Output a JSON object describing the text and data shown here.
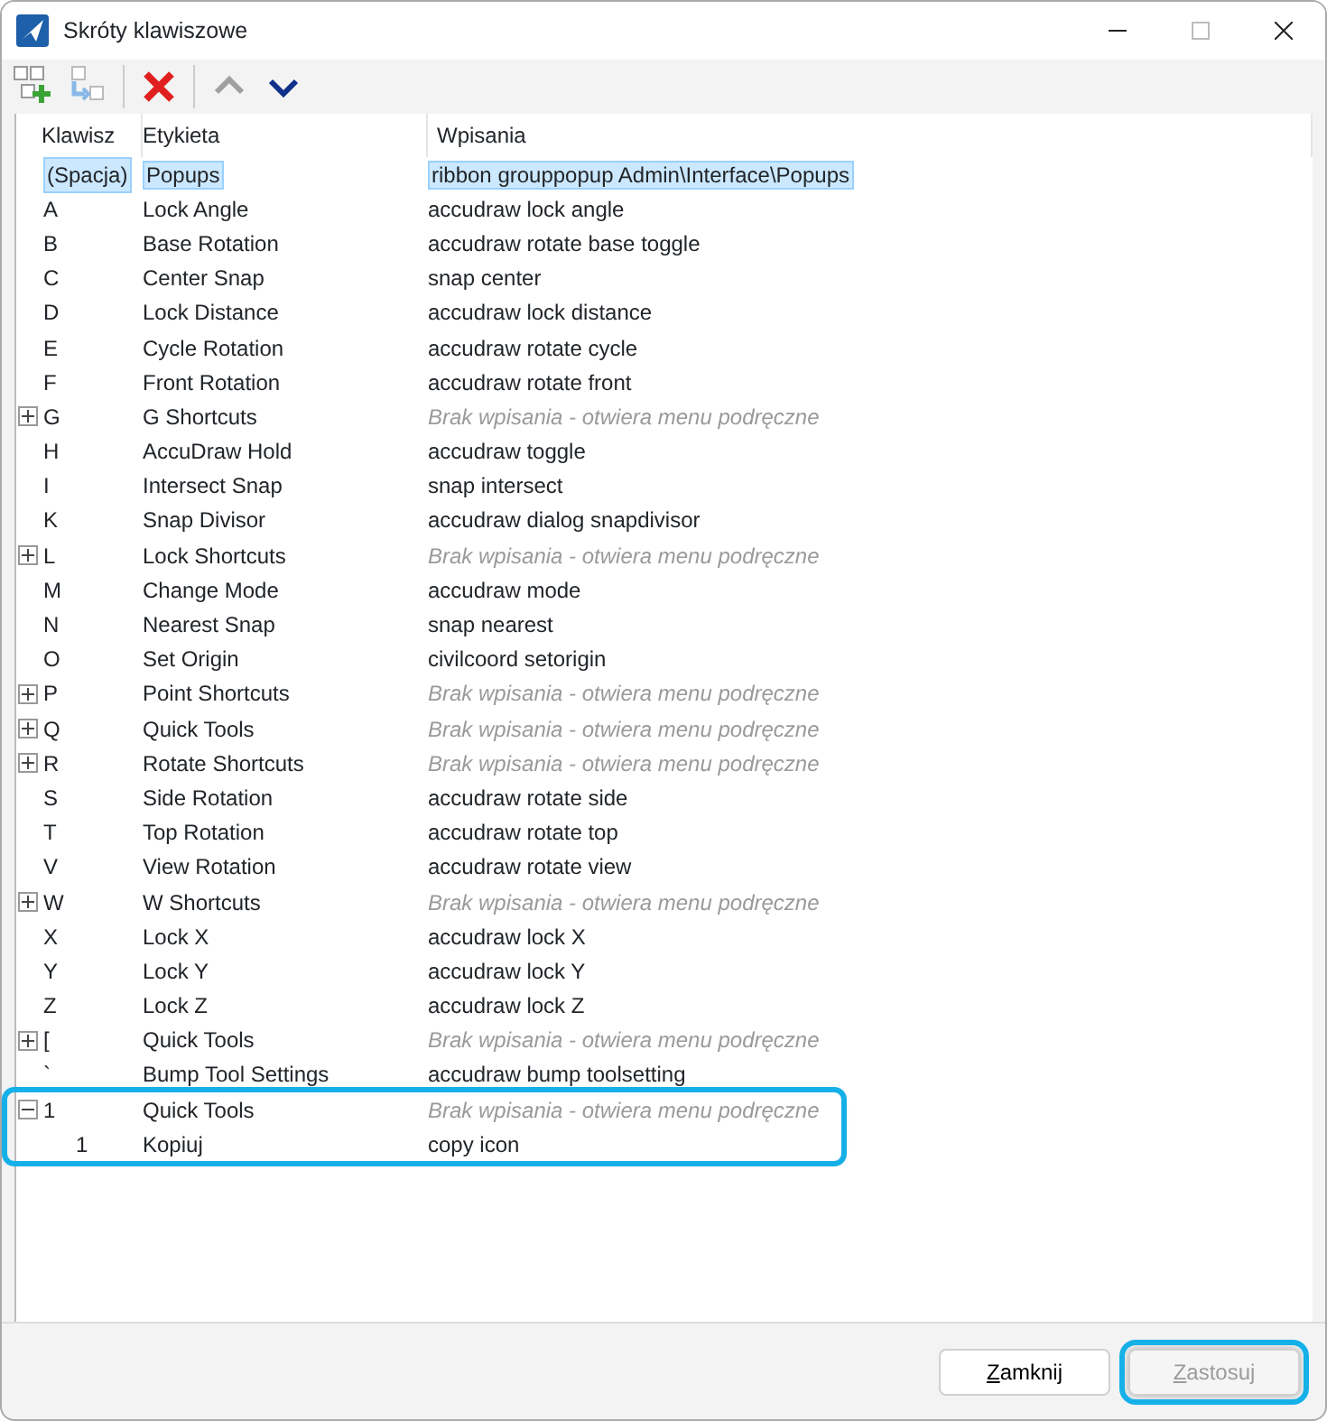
{
  "window": {
    "title": "Skróty klawiszowe"
  },
  "toolbar": [
    {
      "kind": "add",
      "disabled": false
    },
    {
      "kind": "add-child",
      "disabled": true
    },
    {
      "kind": "delete",
      "disabled": false
    },
    {
      "kind": "up",
      "disabled": true
    },
    {
      "kind": "down",
      "disabled": false
    }
  ],
  "table": {
    "columns": [
      "Klawisz",
      "Etykieta",
      "Wpisania"
    ],
    "rows": [
      {
        "key": "(Spacja)",
        "label": "Popups",
        "command": "ribbon grouppopup Admin\\Interface\\Popups",
        "kind": "command",
        "selected": true
      },
      {
        "key": "A",
        "label": "Lock Angle",
        "command": "accudraw lock angle",
        "kind": "command",
        "selected": false
      },
      {
        "key": "B",
        "label": "Base Rotation",
        "command": "accudraw rotate base toggle",
        "kind": "command",
        "selected": false
      },
      {
        "key": "C",
        "label": "Center Snap",
        "command": "snap center",
        "kind": "command",
        "selected": false
      },
      {
        "key": "D",
        "label": "Lock Distance",
        "command": "accudraw lock distance",
        "kind": "command",
        "selected": false
      },
      {
        "key": "E",
        "label": "Cycle Rotation",
        "command": "accudraw rotate cycle",
        "kind": "command",
        "selected": false
      },
      {
        "key": "F",
        "label": "Front Rotation",
        "command": "accudraw rotate front",
        "kind": "command",
        "selected": false
      },
      {
        "key": "G",
        "label": "G Shortcuts",
        "command": "Brak wpisania - otwiera menu podręczne",
        "kind": "submenu",
        "expanded": false,
        "selected": false
      },
      {
        "key": "H",
        "label": "AccuDraw Hold",
        "command": "accudraw toggle",
        "kind": "command",
        "selected": false
      },
      {
        "key": "I",
        "label": "Intersect Snap",
        "command": "snap intersect",
        "kind": "command",
        "selected": false
      },
      {
        "key": "K",
        "label": "Snap Divisor",
        "command": "accudraw dialog snapdivisor",
        "kind": "command",
        "selected": false
      },
      {
        "key": "L",
        "label": "Lock Shortcuts",
        "command": "Brak wpisania - otwiera menu podręczne",
        "kind": "submenu",
        "expanded": false,
        "selected": false
      },
      {
        "key": "M",
        "label": "Change Mode",
        "command": "accudraw mode",
        "kind": "command",
        "selected": false
      },
      {
        "key": "N",
        "label": "Nearest Snap",
        "command": "snap nearest",
        "kind": "command",
        "selected": false
      },
      {
        "key": "O",
        "label": "Set Origin",
        "command": "civilcoord setorigin",
        "kind": "command",
        "selected": false
      },
      {
        "key": "P",
        "label": "Point Shortcuts",
        "command": "Brak wpisania - otwiera menu podręczne",
        "kind": "submenu",
        "expanded": false,
        "selected": false
      },
      {
        "key": "Q",
        "label": "Quick Tools",
        "command": "Brak wpisania - otwiera menu podręczne",
        "kind": "submenu",
        "expanded": false,
        "selected": false
      },
      {
        "key": "R",
        "label": "Rotate Shortcuts",
        "command": "Brak wpisania - otwiera menu podręczne",
        "kind": "submenu",
        "expanded": false,
        "selected": false
      },
      {
        "key": "S",
        "label": "Side Rotation",
        "command": "accudraw rotate side",
        "kind": "command",
        "selected": false
      },
      {
        "key": "T",
        "label": "Top Rotation",
        "command": "accudraw rotate top",
        "kind": "command",
        "selected": false
      },
      {
        "key": "V",
        "label": "View Rotation",
        "command": "accudraw rotate view",
        "kind": "command",
        "selected": false
      },
      {
        "key": "W",
        "label": "W Shortcuts",
        "command": "Brak wpisania - otwiera menu podręczne",
        "kind": "submenu",
        "expanded": false,
        "selected": false
      },
      {
        "key": "X",
        "label": "Lock X",
        "command": "accudraw lock X",
        "kind": "command",
        "selected": false
      },
      {
        "key": "Y",
        "label": "Lock Y",
        "command": "accudraw lock Y",
        "kind": "command",
        "selected": false
      },
      {
        "key": "Z",
        "label": "Lock Z",
        "command": "accudraw lock Z",
        "kind": "command",
        "selected": false
      },
      {
        "key": "[",
        "label": "Quick Tools",
        "command": "Brak wpisania - otwiera menu podręczne",
        "kind": "submenu",
        "expanded": false,
        "selected": false
      },
      {
        "key": "`",
        "label": "Bump Tool Settings",
        "command": "accudraw bump toolsetting",
        "kind": "command",
        "selected": false
      },
      {
        "key": "1",
        "label": "Quick Tools",
        "command": "Brak wpisania - otwiera menu podręczne",
        "kind": "submenu",
        "expanded": true,
        "selected": false,
        "highlighted": true,
        "children": [
          {
            "key": "1",
            "label": "Kopiuj",
            "command": "copy icon",
            "kind": "command",
            "selected": false
          }
        ]
      }
    ]
  },
  "buttons": [
    {
      "label": "Zamknij",
      "disabled": false,
      "highlighted": false
    },
    {
      "label": "Zastosuj",
      "disabled": true,
      "highlighted": true
    }
  ]
}
